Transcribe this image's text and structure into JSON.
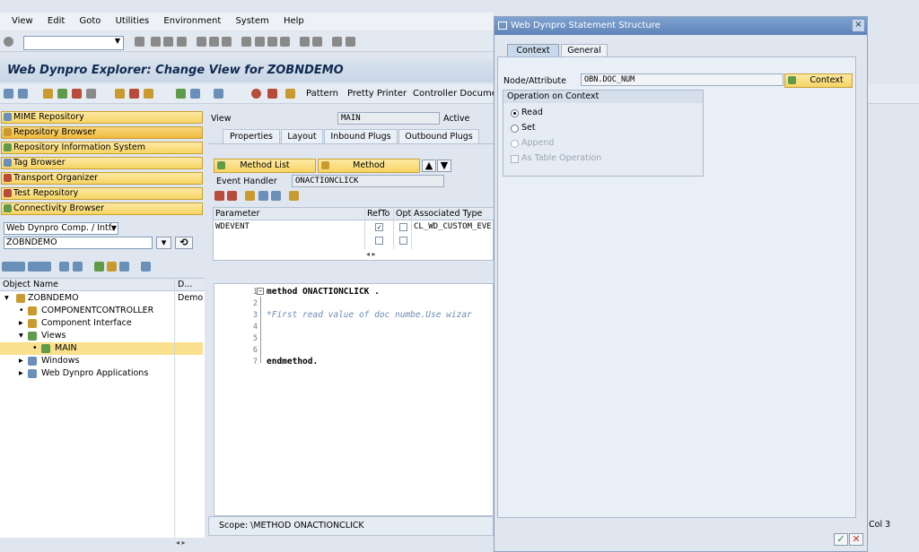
{
  "menu": {
    "items": [
      "View",
      "Edit",
      "Goto",
      "Utilities",
      "Environment",
      "System",
      "Help"
    ]
  },
  "window": {
    "title": "Web Dynpro Explorer: Change View for ZOBNDEMO"
  },
  "toolbar": {
    "pattern": "Pattern",
    "pretty_printer": "Pretty Printer",
    "controller_doc": "Controller Document"
  },
  "nav": {
    "buttons": [
      "MIME Repository",
      "Repository Browser",
      "Repository Information System",
      "Tag Browser",
      "Transport Organizer",
      "Test Repository",
      "Connectivity Browser"
    ],
    "object_type": "Web Dynpro Comp. / Intf.",
    "object_name": "ZOBNDEMO"
  },
  "tree": {
    "header_name": "Object Name",
    "header_desc": "D...",
    "rows": [
      {
        "label": "ZOBNDEMO",
        "desc": "Demo"
      },
      {
        "label": "COMPONENTCONTROLLER",
        "desc": ""
      },
      {
        "label": "Component Interface",
        "desc": ""
      },
      {
        "label": "Views",
        "desc": ""
      },
      {
        "label": "MAIN",
        "desc": ""
      },
      {
        "label": "Windows",
        "desc": ""
      },
      {
        "label": "Web Dynpro Applications",
        "desc": ""
      }
    ]
  },
  "view": {
    "label": "View",
    "name": "MAIN",
    "status": "Active"
  },
  "tabs": [
    "Properties",
    "Layout",
    "Inbound Plugs",
    "Outbound Plugs"
  ],
  "methods": {
    "method_list": "Method List",
    "method": "Method",
    "event_handler_label": "Event Handler",
    "event_handler": "ONACTIONCLICK"
  },
  "params": {
    "headers": [
      "Parameter",
      "RefTo",
      "Opt",
      "Associated Type"
    ],
    "row": {
      "name": "WDEVENT",
      "type": "CL_WD_CUSTOM_EVE"
    }
  },
  "code": {
    "lines": [
      "method ONACTIONCLICK .",
      "",
      "*First read value of doc numbe.Use wizar",
      "",
      "",
      "",
      "endmethod."
    ],
    "scope": "Scope: \\METHOD ONACTIONCLICK",
    "col_label": "Col",
    "col_value": "3"
  },
  "dialog": {
    "title": "Web Dynpro Statement Structure",
    "tabs": [
      "Context",
      "General"
    ],
    "node_label": "Node/Attribute",
    "node_value": "OBN.DOC_NUM",
    "context_button": "Context",
    "group_title": "Operation on Context",
    "options": [
      "Read",
      "Set",
      "Append",
      "As Table Operation"
    ]
  }
}
